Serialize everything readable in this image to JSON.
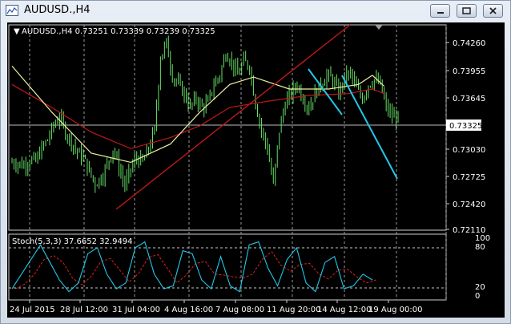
{
  "window": {
    "title": "AUDUSD.,H4",
    "buttons": [
      "minimize",
      "restore",
      "close"
    ]
  },
  "colors": {
    "background": "#000000",
    "candles": "#66e066",
    "ma_fast": "#f0f0a0",
    "ma_slow": "#c01818",
    "trendline": "#c01818",
    "aqua_line": "#23c8e8",
    "stoch_main": "#23c8e8",
    "stoch_signal": "#e02020",
    "grid": "#d0d0d0",
    "text": "#ffffff"
  },
  "main_panel": {
    "info": "AUDUSD.,H4  0.73251 0.73339 0.73239 0.73325",
    "current_price": "0.73325",
    "price_labels": [
      "0.74260",
      "0.73955",
      "0.73645",
      "0.73030",
      "0.72725",
      "0.72420",
      "0.72110"
    ]
  },
  "stoch_panel": {
    "info": "Stoch(5,3,3) 37.6652 32.9494",
    "levels": [
      "100",
      "80",
      "20",
      "0"
    ]
  },
  "x_axis_labels": [
    "24 Jul 2015",
    "28 Jul 12:00",
    "31 Jul 04:00",
    "4 Aug 16:00",
    "7 Aug 08:00",
    "11 Aug 20:00",
    "14 Aug 12:00",
    "19 Aug 00:00"
  ],
  "chart_data": {
    "type": "candlestick",
    "symbol": "AUDUSD.",
    "timeframe": "H4",
    "ohlc": [
      0.73251,
      0.73339,
      0.73239,
      0.73325
    ],
    "y_range": [
      0.7211,
      0.7435
    ],
    "close_path": [
      [
        0,
        0.7285
      ],
      [
        3,
        0.7284
      ],
      [
        6,
        0.7282
      ],
      [
        9,
        0.7288
      ],
      [
        12,
        0.7286
      ],
      [
        15,
        0.73
      ],
      [
        18,
        0.731
      ],
      [
        21,
        0.7325
      ],
      [
        24,
        0.7335
      ],
      [
        27,
        0.7318
      ],
      [
        30,
        0.7308
      ],
      [
        33,
        0.7296
      ],
      [
        36,
        0.729
      ],
      [
        39,
        0.7275
      ],
      [
        42,
        0.7262
      ],
      [
        45,
        0.7268
      ],
      [
        48,
        0.7282
      ],
      [
        51,
        0.73
      ],
      [
        54,
        0.728
      ],
      [
        57,
        0.726
      ],
      [
        60,
        0.7278
      ],
      [
        63,
        0.729
      ],
      [
        66,
        0.7285
      ],
      [
        69,
        0.73
      ],
      [
        72,
        0.732
      ],
      [
        75,
        0.74
      ],
      [
        78,
        0.7415
      ],
      [
        81,
        0.738
      ],
      [
        84,
        0.737
      ],
      [
        87,
        0.736
      ],
      [
        90,
        0.7345
      ],
      [
        93,
        0.7355
      ],
      [
        96,
        0.7345
      ],
      [
        99,
        0.735
      ],
      [
        102,
        0.737
      ],
      [
        105,
        0.738
      ],
      [
        108,
        0.7405
      ],
      [
        111,
        0.7395
      ],
      [
        114,
        0.738
      ],
      [
        117,
        0.7395
      ],
      [
        120,
        0.739
      ],
      [
        123,
        0.735
      ],
      [
        126,
        0.732
      ],
      [
        129,
        0.73
      ],
      [
        132,
        0.726
      ],
      [
        135,
        0.732
      ],
      [
        138,
        0.735
      ],
      [
        141,
        0.736
      ],
      [
        144,
        0.737
      ],
      [
        147,
        0.7355
      ],
      [
        150,
        0.7345
      ],
      [
        153,
        0.736
      ],
      [
        156,
        0.737
      ],
      [
        159,
        0.738
      ],
      [
        162,
        0.7375
      ],
      [
        165,
        0.736
      ],
      [
        168,
        0.7378
      ],
      [
        171,
        0.7382
      ],
      [
        174,
        0.7365
      ],
      [
        177,
        0.7355
      ],
      [
        180,
        0.737
      ],
      [
        183,
        0.7375
      ],
      [
        186,
        0.737
      ],
      [
        189,
        0.7345
      ],
      [
        192,
        0.7335
      ],
      [
        195,
        0.7333
      ]
    ],
    "ma_fast": [
      [
        0,
        0.739
      ],
      [
        20,
        0.734
      ],
      [
        40,
        0.7295
      ],
      [
        60,
        0.7285
      ],
      [
        80,
        0.7305
      ],
      [
        95,
        0.734
      ],
      [
        110,
        0.737
      ],
      [
        122,
        0.7378
      ],
      [
        140,
        0.7365
      ],
      [
        160,
        0.7365
      ],
      [
        175,
        0.737
      ],
      [
        182,
        0.738
      ],
      [
        188,
        0.7368
      ]
    ],
    "ma_slow": [
      [
        0,
        0.737
      ],
      [
        20,
        0.7345
      ],
      [
        40,
        0.7318
      ],
      [
        60,
        0.73
      ],
      [
        80,
        0.7312
      ],
      [
        95,
        0.7325
      ],
      [
        110,
        0.7345
      ],
      [
        130,
        0.7352
      ],
      [
        150,
        0.7358
      ],
      [
        170,
        0.736
      ],
      [
        182,
        0.7365
      ],
      [
        188,
        0.736
      ]
    ],
    "stoch_main": [
      [
        0,
        15
      ],
      [
        4,
        40
      ],
      [
        8,
        65
      ],
      [
        12,
        90
      ],
      [
        16,
        60
      ],
      [
        20,
        30
      ],
      [
        24,
        10
      ],
      [
        28,
        25
      ],
      [
        32,
        75
      ],
      [
        36,
        85
      ],
      [
        40,
        40
      ],
      [
        44,
        15
      ],
      [
        48,
        25
      ],
      [
        52,
        85
      ],
      [
        56,
        95
      ],
      [
        60,
        40
      ],
      [
        64,
        15
      ],
      [
        68,
        20
      ],
      [
        72,
        80
      ],
      [
        76,
        75
      ],
      [
        80,
        30
      ],
      [
        84,
        15
      ],
      [
        88,
        70
      ],
      [
        92,
        20
      ],
      [
        96,
        10
      ],
      [
        100,
        90
      ],
      [
        104,
        95
      ],
      [
        108,
        50
      ],
      [
        112,
        20
      ],
      [
        116,
        65
      ],
      [
        120,
        85
      ],
      [
        124,
        25
      ],
      [
        128,
        10
      ],
      [
        132,
        60
      ],
      [
        136,
        70
      ],
      [
        140,
        15
      ],
      [
        144,
        20
      ],
      [
        148,
        40
      ],
      [
        152,
        30
      ]
    ]
  }
}
